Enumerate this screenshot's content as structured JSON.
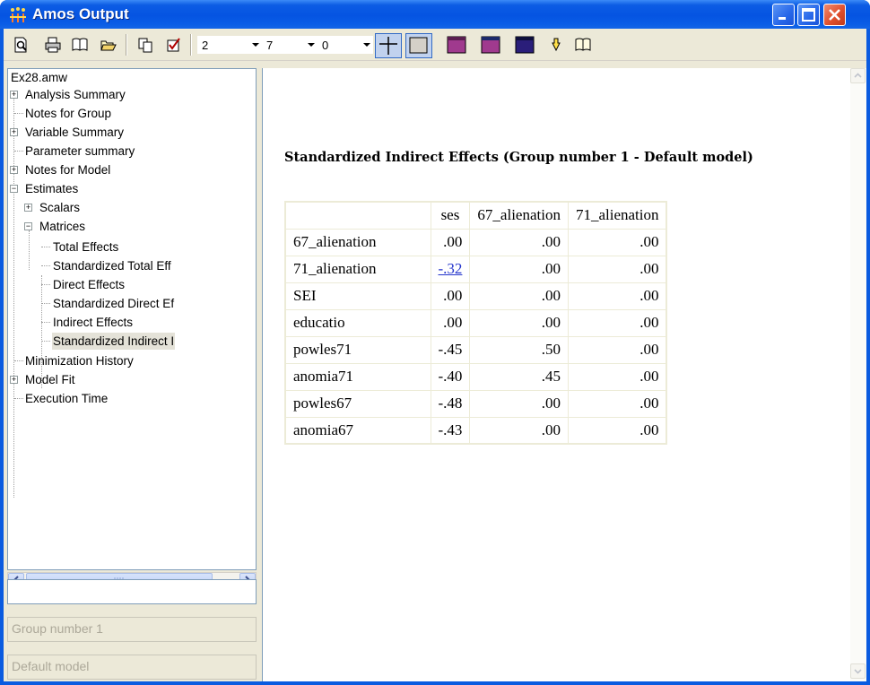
{
  "window": {
    "title": "Amos Output"
  },
  "toolbar": {
    "combo_decimals": "2",
    "combo_width": "7",
    "combo_third": "0"
  },
  "tree": [
    {
      "label": "Ex28.amw"
    },
    {
      "label": "Analysis Summary",
      "expander": "+"
    },
    {
      "label": "Notes for Group"
    },
    {
      "label": "Variable Summary",
      "expander": "+"
    },
    {
      "label": "Parameter summary"
    },
    {
      "label": "Notes for Model",
      "expander": "+"
    },
    {
      "label": "Estimates",
      "expander": "−"
    },
    {
      "label": "Scalars",
      "expander": "+"
    },
    {
      "label": "Matrices",
      "expander": "−"
    },
    {
      "label": "Total Effects"
    },
    {
      "label": "Standardized Total Eff"
    },
    {
      "label": "Direct Effects"
    },
    {
      "label": "Standardized Direct Ef"
    },
    {
      "label": "Indirect Effects"
    },
    {
      "label": "Standardized Indirect I",
      "selected": true
    },
    {
      "label": "Minimization History"
    },
    {
      "label": "Model Fit",
      "expander": "+"
    },
    {
      "label": "Execution Time"
    }
  ],
  "fields": {
    "empty": "",
    "group": "Group number 1",
    "model": "Default model"
  },
  "content": {
    "title": "Standardized Indirect Effects (Group number 1 - Default model)",
    "columns": [
      "",
      "ses",
      "67_alienation",
      "71_alienation"
    ],
    "rows": [
      {
        "name": "67_alienation",
        "values": [
          ".00",
          ".00",
          ".00"
        ]
      },
      {
        "name": "71_alienation",
        "values": [
          "-.32",
          ".00",
          ".00"
        ]
      },
      {
        "name": "SEI",
        "values": [
          ".00",
          ".00",
          ".00"
        ]
      },
      {
        "name": "educatio",
        "values": [
          ".00",
          ".00",
          ".00"
        ]
      },
      {
        "name": "powles71",
        "values": [
          "-.45",
          ".50",
          ".00"
        ]
      },
      {
        "name": "anomia71",
        "values": [
          "-.40",
          ".45",
          ".00"
        ]
      },
      {
        "name": "powles67",
        "values": [
          "-.48",
          ".00",
          ".00"
        ]
      },
      {
        "name": "anomia67",
        "values": [
          "-.43",
          ".00",
          ".00"
        ]
      }
    ]
  },
  "colors": {
    "titlebar": "#0554e2",
    "client_bg": "#ece9d8",
    "link": "#2233cc"
  }
}
